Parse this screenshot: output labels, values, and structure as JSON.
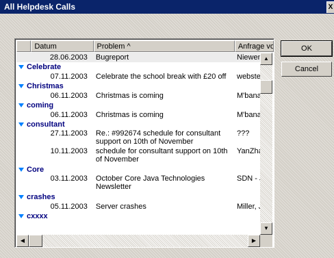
{
  "window": {
    "title": "All Helpdesk Calls",
    "close_glyph": "X"
  },
  "columns": {
    "c0": "",
    "date": "Datum",
    "problem": "Problem ^",
    "sender": "Anfrage vor"
  },
  "rows": [
    {
      "kind": "item",
      "date": "28.06.2003",
      "problem": "Bugreport",
      "sender": "Niewenc"
    },
    {
      "kind": "group",
      "label": "Celebrate"
    },
    {
      "kind": "item",
      "date": "07.11.2003",
      "problem": "Celebrate the school break with £20 off",
      "sender": "webster"
    },
    {
      "kind": "group",
      "label": "Christmas"
    },
    {
      "kind": "item",
      "date": "06.11.2003",
      "problem": "Christmas is coming",
      "sender": "M'bana,"
    },
    {
      "kind": "group",
      "label": "coming"
    },
    {
      "kind": "item",
      "date": "06.11.2003",
      "problem": "Christmas is coming",
      "sender": "M'bana,"
    },
    {
      "kind": "group",
      "label": "consultant"
    },
    {
      "kind": "item",
      "tall": true,
      "date": "27.11.2003",
      "problem": "Re.: #992674 schedule for consultant support on 10th of November",
      "sender": "???"
    },
    {
      "kind": "item",
      "tall": true,
      "date": "10.11.2003",
      "problem": "schedule for consultant support on 10th of November",
      "sender": "YanZhar"
    },
    {
      "kind": "group",
      "label": "Core"
    },
    {
      "kind": "item",
      "tall": true,
      "date": "03.11.2003",
      "problem": "October Core Java Technologies Newsletter",
      "sender": "SDN - JL Staff"
    },
    {
      "kind": "group",
      "label": "crashes"
    },
    {
      "kind": "item",
      "date": "05.11.2003",
      "problem": "Server crashes",
      "sender": "Miller, Jo"
    },
    {
      "kind": "group",
      "label": "cxxxx"
    }
  ],
  "buttons": {
    "ok": "OK",
    "cancel": "Cancel"
  },
  "scroll": {
    "up": "▲",
    "down": "▼",
    "left": "◀",
    "right": "▶"
  }
}
